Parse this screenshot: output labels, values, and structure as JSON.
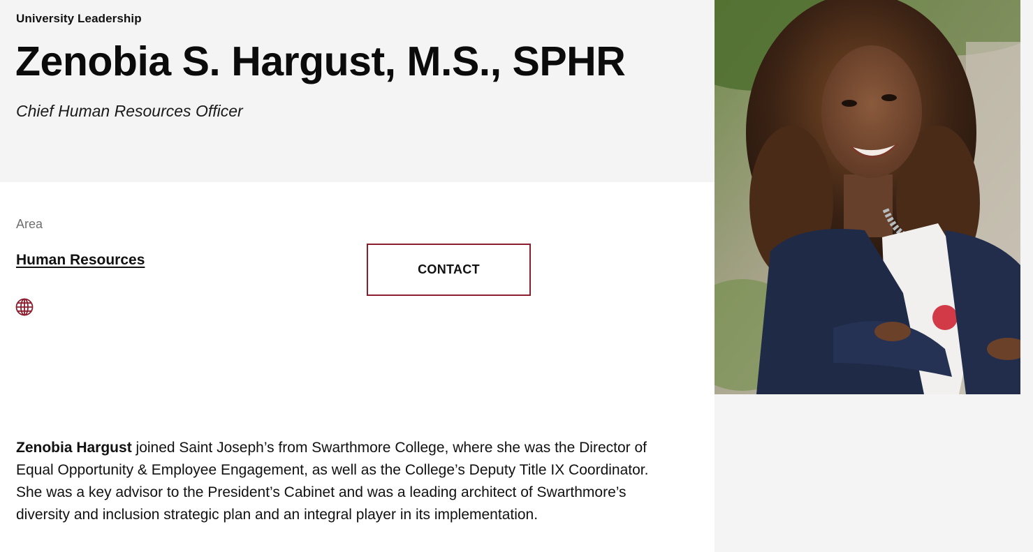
{
  "header": {
    "eyebrow": "University Leadership",
    "name": "Zenobia S. Hargust, M.S., SPHR",
    "title": "Chief Human Resources Officer"
  },
  "details": {
    "area_label": "Area",
    "area_value": "Human Resources",
    "website_icon": "globe-icon",
    "contact_label": "CONTACT"
  },
  "bio": {
    "lead": "Zenobia Hargust",
    "text": " joined Saint Joseph’s from Swarthmore College, where she was the Director of Equal Opportunity & Employee Engagement, as well as the College’s Deputy Title IX Coordinator. She was a key advisor to the President’s Cabinet and was a leading architect of Swarthmore’s diversity and inclusion strategic plan and an integral player in its implementation."
  },
  "colors": {
    "accent": "#8c1d2e",
    "band_background": "#f4f4f4"
  }
}
